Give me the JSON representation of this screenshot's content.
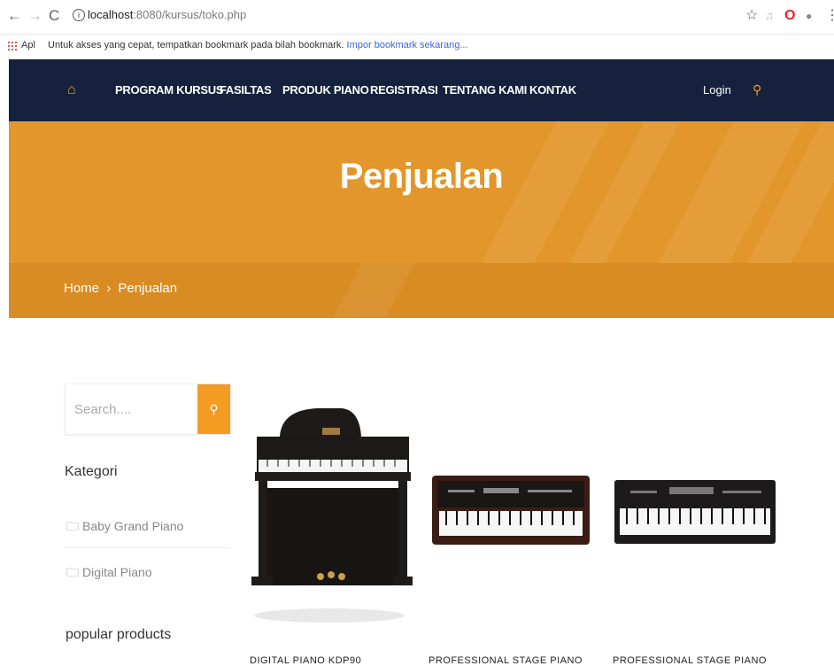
{
  "browser": {
    "url_host": "localhost",
    "url_rest": ":8080/kursus/toko.php",
    "bookmarks_apps": "Apl",
    "bookmarks_hint": "Untuk akses yang cepat, tempatkan bookmark pada bilah bookmark.",
    "bookmarks_import": "Impor bookmark sekarang..."
  },
  "nav": {
    "items": [
      "PROGRAM KURSUS",
      "FASILTAS",
      "PRODUK PIANO",
      "REGISTRASI",
      "TENTANG KAMI",
      "KONTAK"
    ],
    "login": "Login"
  },
  "hero": {
    "title": "Penjualan",
    "breadcrumb_home": "Home",
    "breadcrumb_sep": "›",
    "breadcrumb_current": "Penjualan"
  },
  "sidebar": {
    "search_placeholder": "Search....",
    "category_title": "Kategori",
    "categories": [
      "Baby Grand Piano",
      "Digital Piano"
    ],
    "popular_title": "popular products"
  },
  "products": [
    {
      "name": "DIGITAL PIANO KDP90"
    },
    {
      "name": "PROFESSIONAL STAGE PIANO"
    },
    {
      "name": "PROFESSIONAL STAGE PIANO"
    }
  ],
  "colors": {
    "accent": "#f39c21",
    "nav_bg": "#16213e",
    "hero_bg": "#e2962b"
  }
}
